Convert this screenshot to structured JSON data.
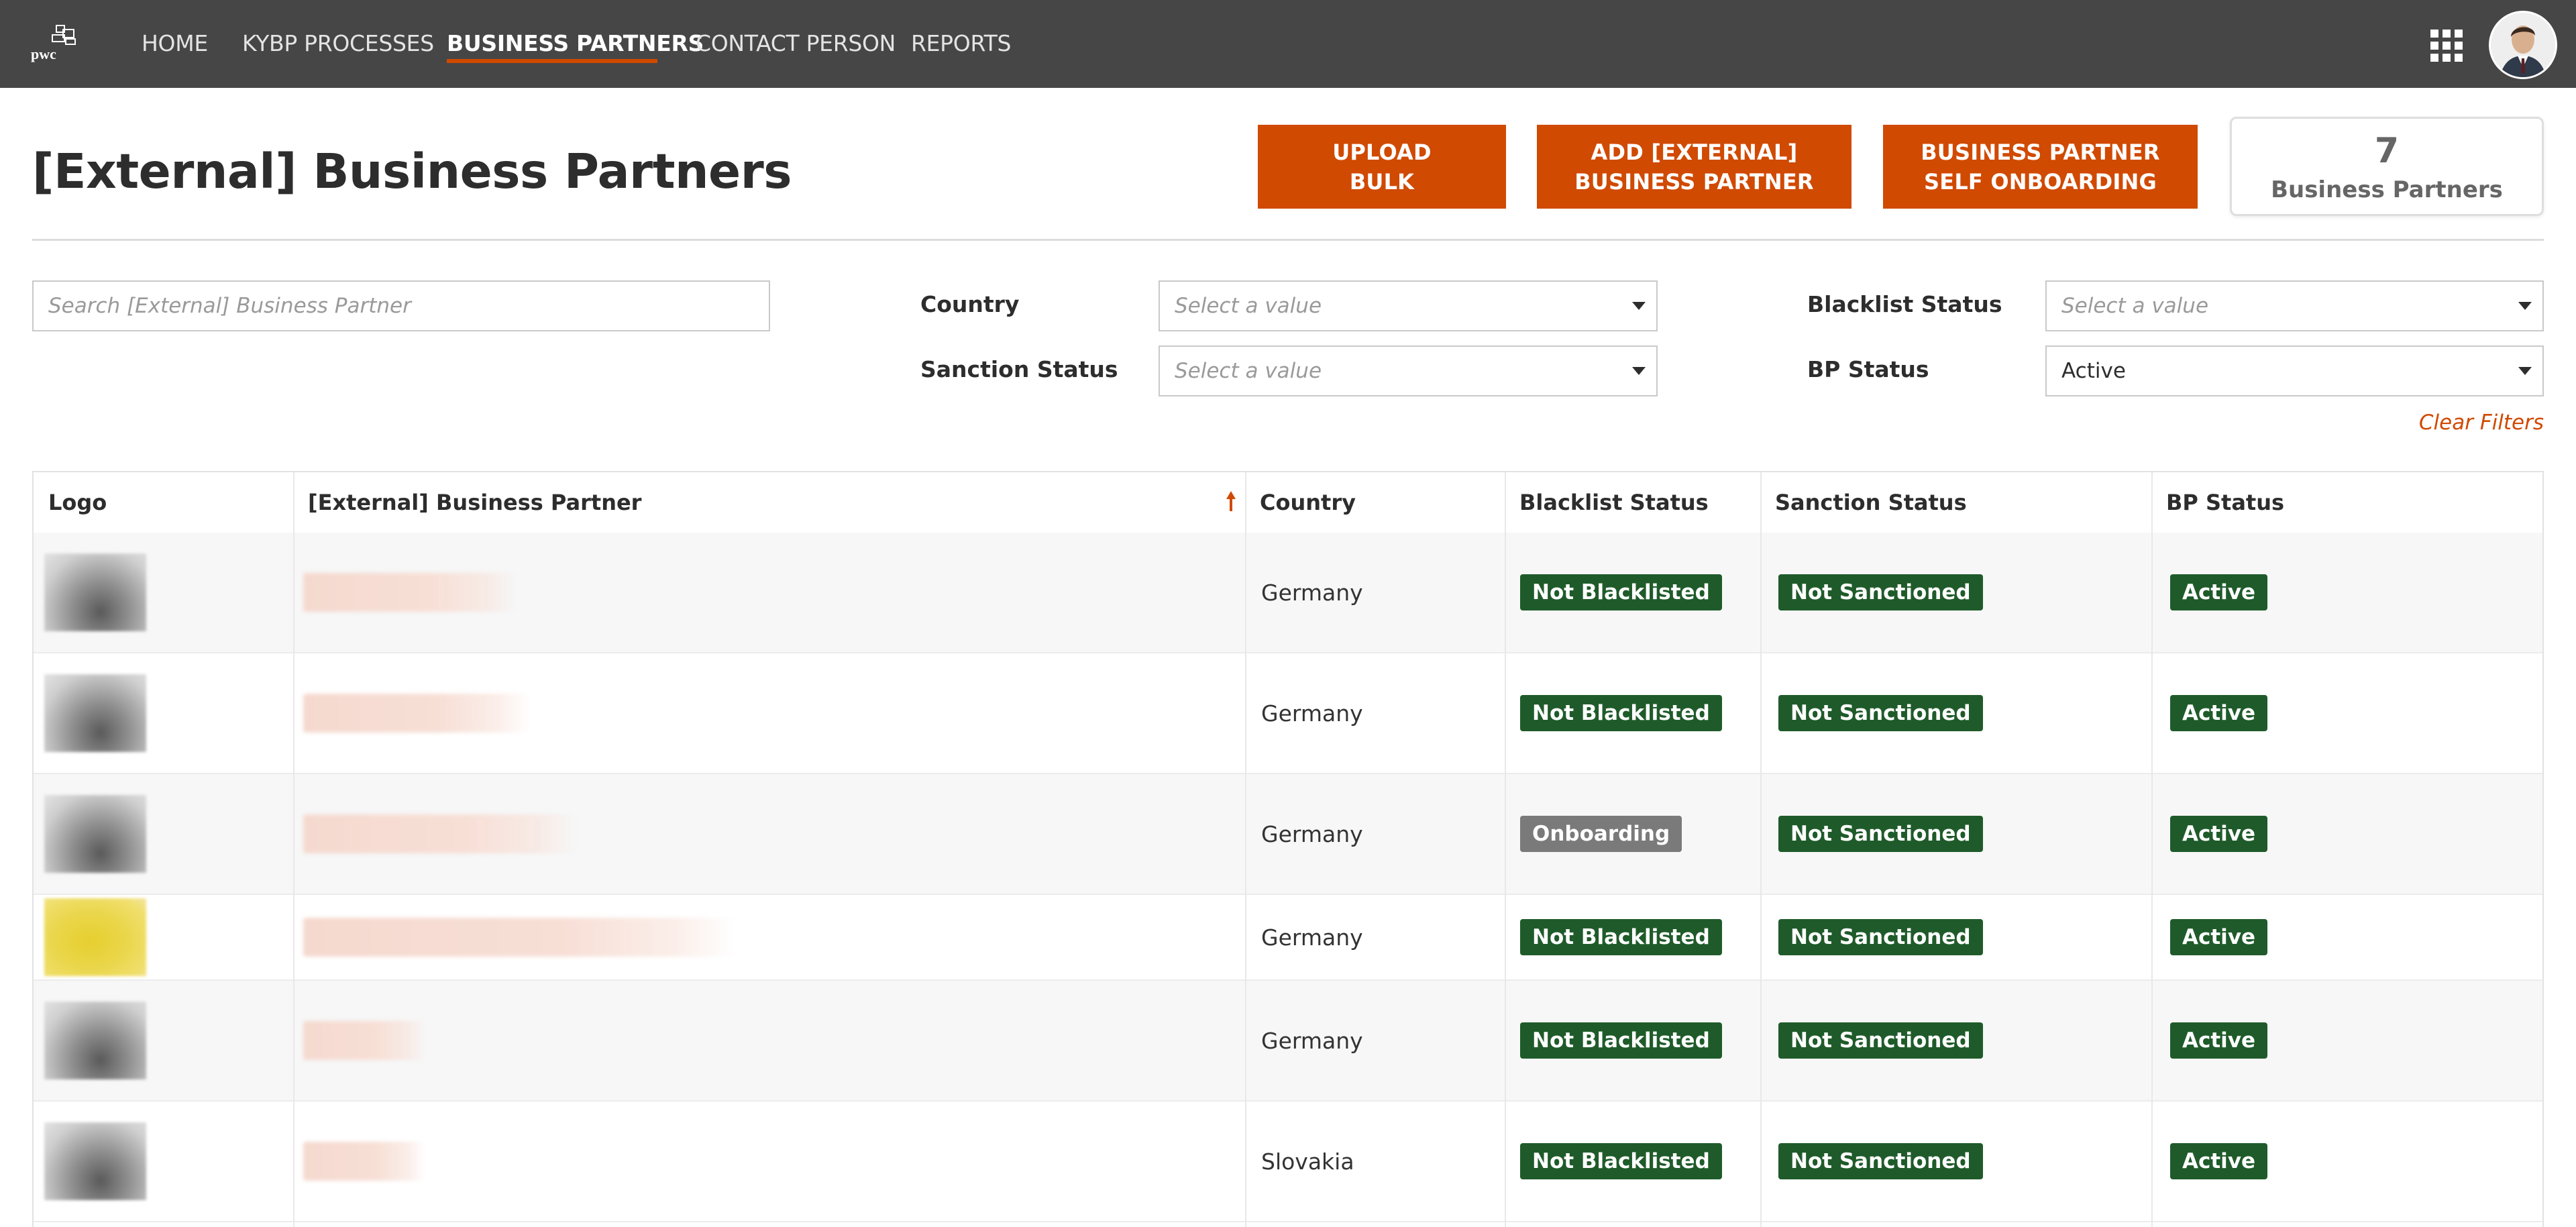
{
  "nav": {
    "logo_text": "pwc",
    "items": [
      {
        "label": "HOME",
        "active": false
      },
      {
        "label": "KYBP PROCESSES",
        "active": false
      },
      {
        "label": "BUSINESS PARTNERS",
        "active": true
      },
      {
        "label": "CONTACT PERSON",
        "active": false
      },
      {
        "label": "REPORTS",
        "active": false
      }
    ],
    "apps_icon": "grid-icon",
    "avatar_icon": "user-avatar"
  },
  "header": {
    "title": "[External] Business Partners",
    "buttons": {
      "upload_line1": "UPLOAD",
      "upload_line2": "BULK",
      "add_line1": "ADD [EXTERNAL]",
      "add_line2": "BUSINESS PARTNER",
      "self_line1": "BUSINESS PARTNER",
      "self_line2": "SELF ONBOARDING"
    },
    "count": {
      "value": "7",
      "label": "Business Partners"
    }
  },
  "filters": {
    "search_placeholder": "Search [External] Business Partner",
    "country": {
      "label": "Country",
      "value": "Select a value"
    },
    "sanction_status": {
      "label": "Sanction Status",
      "value": "Select a value"
    },
    "blacklist_status": {
      "label": "Blacklist Status",
      "value": "Select a value"
    },
    "bp_status": {
      "label": "BP Status",
      "value": "Active"
    },
    "clear": "Clear Filters"
  },
  "table": {
    "columns": {
      "logo": "Logo",
      "partner": "[External] Business Partner",
      "country": "Country",
      "blacklist": "Blacklist Status",
      "sanction": "Sanction Status",
      "bp_status": "BP Status"
    },
    "sort_icon": "sort-ascending-arrow-icon",
    "rows": [
      {
        "country": "Germany",
        "blacklist": "Not Blacklisted",
        "sanction": "Not Sanctioned",
        "bp_status": "Active"
      },
      {
        "country": "Germany",
        "blacklist": "Not Blacklisted",
        "sanction": "Not Sanctioned",
        "bp_status": "Active"
      },
      {
        "country": "Germany",
        "blacklist": "Onboarding",
        "sanction": "Not Sanctioned",
        "bp_status": "Active"
      },
      {
        "country": "Germany",
        "blacklist": "Not Blacklisted",
        "sanction": "Not Sanctioned",
        "bp_status": "Active"
      },
      {
        "country": "Germany",
        "blacklist": "Not Blacklisted",
        "sanction": "Not Sanctioned",
        "bp_status": "Active"
      },
      {
        "country": "Slovakia",
        "blacklist": "Not Blacklisted",
        "sanction": "Not Sanctioned",
        "bp_status": "Active"
      }
    ]
  },
  "colors": {
    "accent": "#d04a02",
    "nav_bg": "#464646",
    "badge_green": "#1f5b2a",
    "badge_gray": "#7a7a7a"
  }
}
